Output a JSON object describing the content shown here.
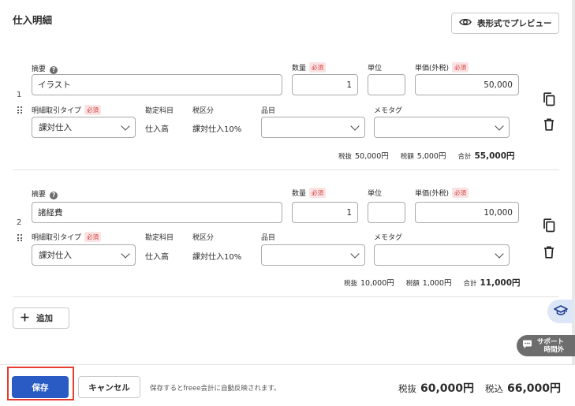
{
  "section_title": "仕入明細",
  "preview_button": "表形式でプレビュー",
  "labels": {
    "summary": "摘要",
    "quantity": "数量",
    "unit": "単位",
    "unit_price": "単価(外税)",
    "required": "必須",
    "help": "?",
    "detail_type": "明細取引タイプ",
    "account": "勘定科目",
    "tax_class": "税区分",
    "item": "品目",
    "memo_tag": "メモタグ",
    "tax_excl": "税抜",
    "tax_amount": "税額",
    "total": "合計"
  },
  "rows": [
    {
      "number": "1",
      "summary": "イラスト",
      "quantity": "1",
      "unit": "",
      "unit_price": "50,000",
      "detail_type": "課対仕入",
      "account": "仕入高",
      "tax_class": "課対仕入10%",
      "item": "",
      "memo_tag": "",
      "tax_excl_value": "50,000円",
      "tax_amount_value": "5,000円",
      "total_value": "55,000円"
    },
    {
      "number": "2",
      "summary": "諸経費",
      "quantity": "1",
      "unit": "",
      "unit_price": "10,000",
      "detail_type": "課対仕入",
      "account": "仕入高",
      "tax_class": "課対仕入10%",
      "item": "",
      "memo_tag": "",
      "tax_excl_value": "10,000円",
      "tax_amount_value": "1,000円",
      "total_value": "11,000円"
    }
  ],
  "add_button": "追加",
  "support": {
    "line1": "サポート",
    "line2": "時間外"
  },
  "footer": {
    "save": "保存",
    "cancel": "キャンセル",
    "note": "保存するとfreee会計に自動反映されます。",
    "tax_excl_label": "税抜",
    "tax_excl_total": "60,000円",
    "tax_incl_label": "税込",
    "tax_incl_total": "66,000円"
  },
  "colors": {
    "primary": "#2a5bc4",
    "required_bg": "#fbe3e4",
    "required_text": "#d33b3b",
    "highlight_outline": "#e53c2e",
    "support_bg": "#6d6d6d"
  },
  "icons": [
    "eye-icon",
    "help-icon",
    "drag-handle-icon",
    "chevron-down-icon",
    "copy-icon",
    "trash-icon",
    "plus-icon",
    "graduation-cap-icon",
    "chat-icon"
  ]
}
